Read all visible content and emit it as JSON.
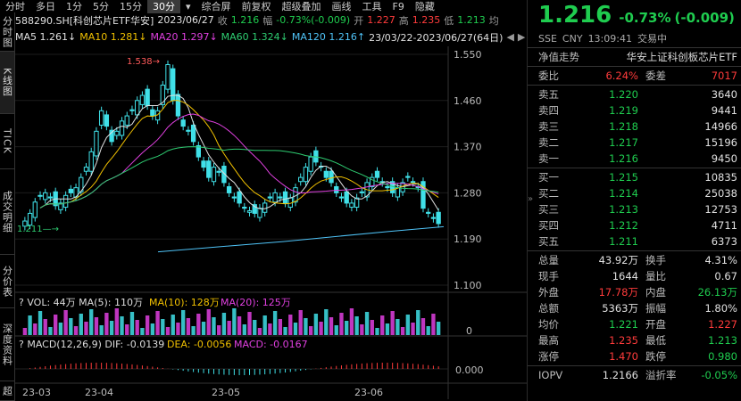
{
  "menu": [
    "分时",
    "多日",
    "1分",
    "5分",
    "15分",
    "30分",
    "▾",
    "综合屏",
    "前复权",
    "超级叠加",
    "画线",
    "工具",
    "F9",
    "隐藏"
  ],
  "left_tabs": [
    "分时图",
    "K线图",
    "TICK",
    "成交明细",
    "分价表",
    "深度资料",
    "超"
  ],
  "header": {
    "code": "588290.SH[科创芯片ETF华安]",
    "date": "2023/06/27",
    "close_label": "收",
    "close": "1.216",
    "chg_label": "幅",
    "chg": "-0.73%(-0.009)",
    "open_label": "开",
    "open": "1.227",
    "high_label": "高",
    "high": "1.235",
    "low_label": "低",
    "low": "1.213",
    "extra": "均"
  },
  "ma": [
    {
      "name": "MA5",
      "value": "1.261↓",
      "color": "#e0e0e0"
    },
    {
      "name": "MA10",
      "value": "1.281↓",
      "color": "#f0c000"
    },
    {
      "name": "MA20",
      "value": "1.297↓",
      "color": "#e040e0"
    },
    {
      "name": "MA60",
      "value": "1.324↓",
      "color": "#2ecc71"
    },
    {
      "name": "MA120",
      "value": "1.216↑",
      "color": "#4fc3f7"
    }
  ],
  "range": "23/03/22-2023/06/27(64日)",
  "price_axis": [
    "1.550",
    "1.460",
    "1.370",
    "1.280",
    "1.190",
    "1.100"
  ],
  "annotations": {
    "high": "1.538",
    "low": "1.211"
  },
  "vol": {
    "label": "VOL: 44万",
    "ma5": "MA(5): 110万",
    "ma10": "MA(10): 128万",
    "ma20": "MA(20): 125万",
    "axis": "0"
  },
  "macd": {
    "label": "MACD(12,26,9)",
    "dif": "DIF: -0.0139",
    "dea": "DEA: -0.0056",
    "macd": "MACD: -0.0167",
    "axis": "0.000"
  },
  "x_axis": [
    "23-03",
    "23-04",
    "23-05",
    "23-06"
  ],
  "quote": {
    "price": "1.216",
    "chg_pct": "-0.73%",
    "chg": "(-0.009)",
    "exchange": "SSE",
    "currency": "CNY",
    "time": "13:09:41",
    "status": "交易中",
    "name_label": "净值走势",
    "name": "华安上证科创板芯片ETF",
    "weibi_label": "委比",
    "weibi": "6.24%",
    "weicha_label": "委差",
    "weicha": "7017",
    "asks": [
      {
        "label": "卖五",
        "price": "1.220",
        "vol": "3640"
      },
      {
        "label": "卖四",
        "price": "1.219",
        "vol": "9441"
      },
      {
        "label": "卖三",
        "price": "1.218",
        "vol": "14966"
      },
      {
        "label": "卖二",
        "price": "1.217",
        "vol": "15196"
      },
      {
        "label": "卖一",
        "price": "1.216",
        "vol": "9450"
      }
    ],
    "bids": [
      {
        "label": "买一",
        "price": "1.215",
        "vol": "10835"
      },
      {
        "label": "买二",
        "price": "1.214",
        "vol": "25038"
      },
      {
        "label": "买三",
        "price": "1.213",
        "vol": "12753"
      },
      {
        "label": "买四",
        "price": "1.212",
        "vol": "4711"
      },
      {
        "label": "买五",
        "price": "1.211",
        "vol": "6373"
      }
    ],
    "stats": [
      {
        "l1": "总量",
        "v1": "43.92万",
        "c1": "#e0e0e0",
        "l2": "换手",
        "v2": "4.31%",
        "c2": "#e0e0e0"
      },
      {
        "l1": "现手",
        "v1": "1644",
        "c1": "#e0e0e0",
        "l2": "量比",
        "v2": "0.67",
        "c2": "#e0e0e0"
      },
      {
        "l1": "外盘",
        "v1": "17.78万",
        "c1": "#ff3b3b",
        "l2": "内盘",
        "v2": "26.13万",
        "c2": "#1fcc4f"
      },
      {
        "l1": "总额",
        "v1": "5363万",
        "c1": "#e0e0e0",
        "l2": "振幅",
        "v2": "1.80%",
        "c2": "#e0e0e0"
      },
      {
        "l1": "均价",
        "v1": "1.221",
        "c1": "#1fcc4f",
        "l2": "开盘",
        "v2": "1.227",
        "c2": "#ff3b3b"
      },
      {
        "l1": "最高",
        "v1": "1.235",
        "c1": "#ff3b3b",
        "l2": "最低",
        "v2": "1.213",
        "c2": "#1fcc4f"
      },
      {
        "l1": "涨停",
        "v1": "1.470",
        "c1": "#ff3b3b",
        "l2": "跌停",
        "v2": "0.980",
        "c2": "#1fcc4f"
      }
    ],
    "iopv_label": "IOPV",
    "iopv": "1.2166",
    "prem_label": "溢折率",
    "prem": "-0.05%"
  },
  "colors": {
    "up": "#ff3b3b",
    "down": "#1fcc4f",
    "candle_up": "#40e0e8",
    "candle_dn": "#40e0e8"
  }
}
